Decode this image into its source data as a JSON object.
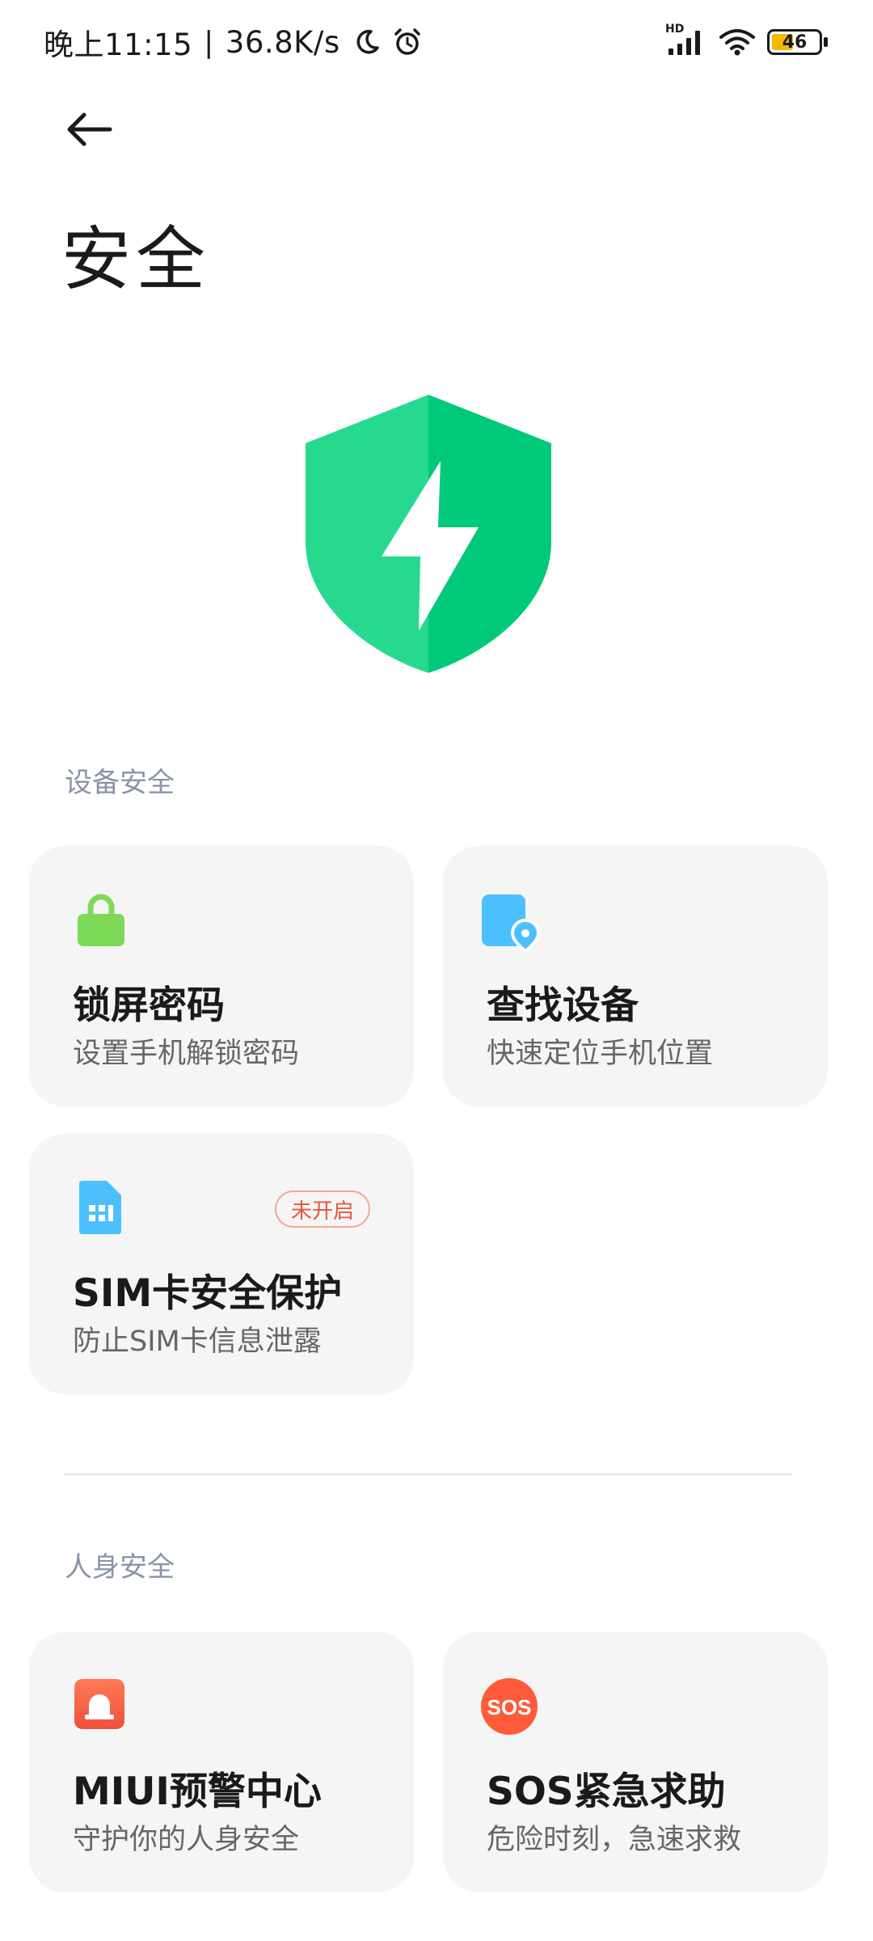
{
  "status_bar": {
    "time": "晚上11:15",
    "separator": "|",
    "net_speed": "36.8K/s",
    "battery_level": "46",
    "signal_label": "HD",
    "battery_color": "#f5b800"
  },
  "header": {
    "title": "安全"
  },
  "sections": [
    {
      "heading": "设备安全",
      "cards": [
        {
          "title": "锁屏密码",
          "subtitle": "设置手机解锁密码",
          "icon": "lock-icon",
          "color": "#7ed957"
        },
        {
          "title": "查找设备",
          "subtitle": "快速定位手机位置",
          "icon": "find-device-icon",
          "color": "#4cc0ff"
        },
        {
          "title": "SIM卡安全保护",
          "subtitle": "防止SIM卡信息泄露",
          "icon": "sim-card-icon",
          "color": "#4cc0ff",
          "badge": "未开启"
        }
      ]
    },
    {
      "heading": "人身安全",
      "cards": [
        {
          "title": "MIUI预警中心",
          "subtitle": "守护你的人身安全",
          "icon": "alarm-icon",
          "color": "#ff6a4d"
        },
        {
          "title": "SOS紧急求助",
          "subtitle": "危险时刻，急速求救",
          "icon": "sos-icon",
          "color": "#ff5b3a"
        }
      ]
    }
  ],
  "colors": {
    "shield_left": "#27d98f",
    "shield_right": "#00c97a",
    "section_heading": "#8a93a8",
    "card_bg": "#f5f5f5",
    "badge": "#e8553d"
  }
}
